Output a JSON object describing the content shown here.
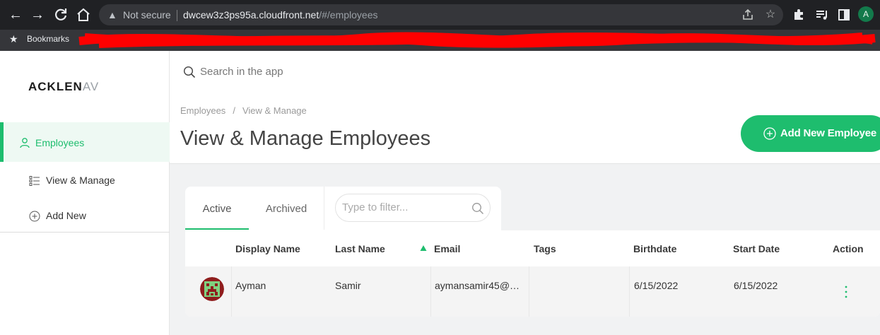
{
  "browser": {
    "nav": {
      "back_icon": "arrow-left-icon",
      "forward_icon": "arrow-right-icon",
      "reload_icon": "reload-icon",
      "home_icon": "home-icon"
    },
    "address_bar": {
      "security_label": "Not secure",
      "host": "dwcew3z3ps95a.cloudfront.net",
      "path": "/#/employees"
    },
    "profile_initial": "A",
    "bookmarks_label": "Bookmarks",
    "colors": {
      "chrome": "#202124",
      "toolbar": "#35363a",
      "redaction": "#ff0000"
    }
  },
  "sidebar": {
    "logo": "ACKLEN",
    "logo_tail": "AV",
    "items": [
      {
        "label": "Employees",
        "icon": "user-icon",
        "active": true
      },
      {
        "label": "View & Manage",
        "icon": "list-icon",
        "active": false
      },
      {
        "label": "Add New",
        "icon": "plus-circle-icon",
        "active": false
      }
    ]
  },
  "header": {
    "search_placeholder": "Search in the app",
    "breadcrumb": [
      "Employees",
      "View & Manage"
    ],
    "breadcrumb_separator": "/",
    "title": "View & Manage Employees",
    "add_button_label": "Add New Employee"
  },
  "employees": {
    "tabs": [
      {
        "label": "Active",
        "active": true
      },
      {
        "label": "Archived",
        "active": false
      }
    ],
    "filter_placeholder": "Type to filter...",
    "columns": [
      "Display Name",
      "Last Name",
      "Email",
      "Tags",
      "Birthdate",
      "Start Date",
      "Action"
    ],
    "sorted_column": "Email",
    "sort_direction": "ascending",
    "rows": [
      {
        "display_name": "Ayman",
        "last_name": "Samir",
        "email": "aymansamir45@…",
        "tags": "",
        "birthdate": "6/15/2022",
        "start_date": "6/15/2022"
      }
    ]
  },
  "colors": {
    "accent": "#1ebd6e",
    "accent_light": "#eef9f3",
    "page_bg": "#f1f2f3"
  }
}
